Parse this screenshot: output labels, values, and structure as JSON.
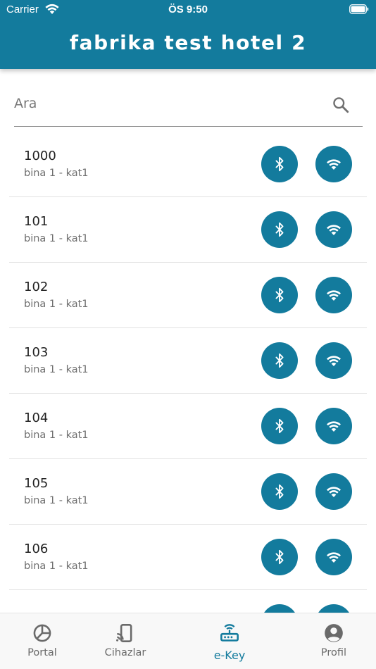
{
  "status_bar": {
    "carrier": "Carrier",
    "time": "ÖS 9:50"
  },
  "header": {
    "title": "fabrika test hotel 2"
  },
  "search": {
    "placeholder": "Ara"
  },
  "rooms": [
    {
      "number": "1000",
      "location": "bina 1 - kat1"
    },
    {
      "number": "101",
      "location": "bina 1 - kat1"
    },
    {
      "number": "102",
      "location": "bina 1 - kat1"
    },
    {
      "number": "103",
      "location": "bina 1 - kat1"
    },
    {
      "number": "104",
      "location": "bina 1 - kat1"
    },
    {
      "number": "105",
      "location": "bina 1 - kat1"
    },
    {
      "number": "106",
      "location": "bina 1 - kat1"
    },
    {
      "number": "",
      "location": ""
    }
  ],
  "row_actions": {
    "bluetooth_icon": "bluetooth-icon",
    "wifi_icon": "wifi-icon"
  },
  "bottom_nav": [
    {
      "label": "Portal",
      "icon": "portal-icon",
      "active": false
    },
    {
      "label": "Cihazlar",
      "icon": "cast-device-icon",
      "active": false
    },
    {
      "label": "e-Key",
      "icon": "router-icon",
      "active": true
    },
    {
      "label": "Profil",
      "icon": "profile-icon",
      "active": false
    }
  ],
  "colors": {
    "primary": "#137b9d",
    "background": "#ffffff",
    "nav_background": "#f8f8f8"
  }
}
